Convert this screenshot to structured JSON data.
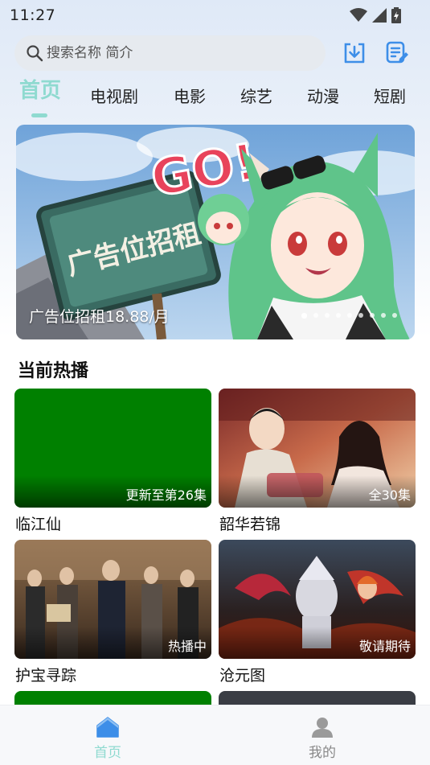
{
  "status_bar": {
    "time": "11:27"
  },
  "search": {
    "placeholder": "搜索名称 简介",
    "value": ""
  },
  "tabs": [
    {
      "label": "首页",
      "active": true
    },
    {
      "label": "电视剧",
      "active": false
    },
    {
      "label": "电影",
      "active": false
    },
    {
      "label": "综艺",
      "active": false
    },
    {
      "label": "动漫",
      "active": false
    },
    {
      "label": "短剧",
      "active": false
    }
  ],
  "banner": {
    "caption": "广告位招租18.88/月",
    "sign_text": "广告位招租",
    "dot_count": 9,
    "active_dot": 0
  },
  "section": {
    "title": "当前热播"
  },
  "cards": [
    {
      "title": "临江仙",
      "badge": "更新至第26集"
    },
    {
      "title": "韶华若锦",
      "badge": "全30集"
    },
    {
      "title": "护宝寻踪",
      "badge": "热播中"
    },
    {
      "title": "沧元图",
      "badge": "敬请期待"
    }
  ],
  "bottom_nav": [
    {
      "label": "首页",
      "icon": "home-icon",
      "active": true
    },
    {
      "label": "我的",
      "icon": "user-icon",
      "active": false
    }
  ],
  "colors": {
    "accent": "#8fdad0",
    "icon_blue": "#3d8ee8"
  }
}
